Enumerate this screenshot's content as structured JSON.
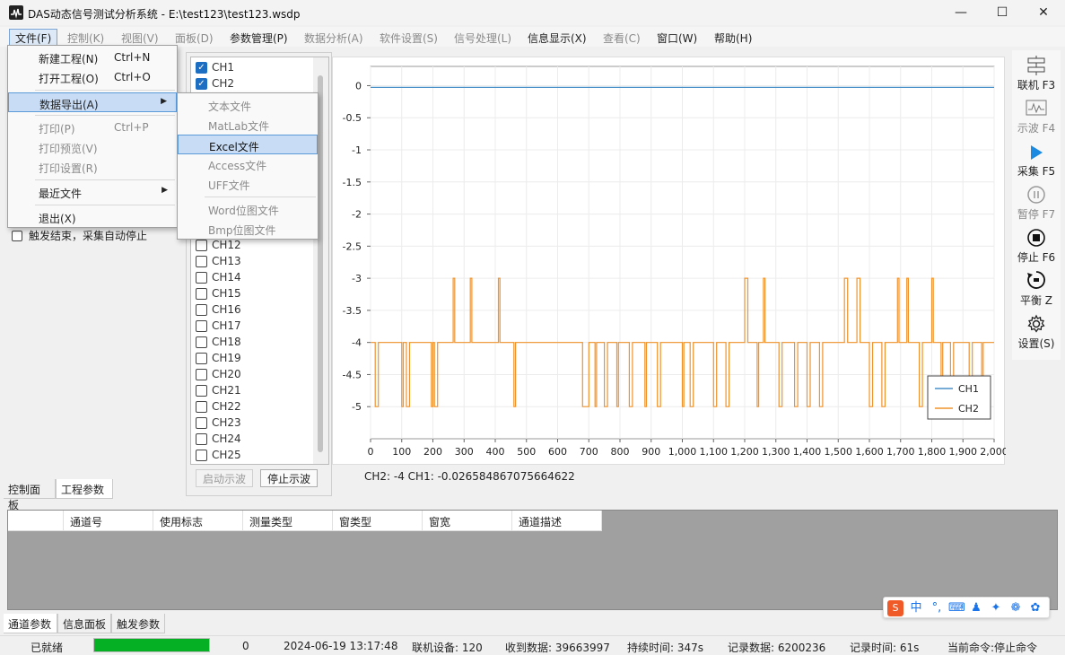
{
  "window": {
    "title": "DAS动态信号测试分析系统 - E:\\test123\\test123.wsdp",
    "minimize": "—",
    "maximize": "☐",
    "close": "✕"
  },
  "menu": [
    {
      "label": "文件(F)",
      "state": "selected"
    },
    {
      "label": "控制(K)",
      "state": "disabled"
    },
    {
      "label": "视图(V)",
      "state": "disabled"
    },
    {
      "label": "面板(D)",
      "state": "disabled"
    },
    {
      "label": "参数管理(P)",
      "state": "enabled"
    },
    {
      "label": "数据分析(A)",
      "state": "disabled"
    },
    {
      "label": "软件设置(S)",
      "state": "disabled"
    },
    {
      "label": "信号处理(L)",
      "state": "disabled"
    },
    {
      "label": "信息显示(X)",
      "state": "enabled"
    },
    {
      "label": "查看(C)",
      "state": "disabled"
    },
    {
      "label": "窗口(W)",
      "state": "enabled"
    },
    {
      "label": "帮助(H)",
      "state": "enabled"
    }
  ],
  "file_menu": {
    "new_project": "新建工程(N)",
    "new_shortcut": "Ctrl+N",
    "open_project": "打开工程(O)",
    "open_shortcut": "Ctrl+O",
    "export": "数据导出(A)",
    "print": "打印(P)",
    "print_shortcut": "Ctrl+P",
    "print_preview": "打印预览(V)",
    "print_setup": "打印设置(R)",
    "recent": "最近文件",
    "exit": "退出(X)"
  },
  "export_menu": {
    "text": "文本文件",
    "matlab": "MatLab文件",
    "excel": "Excel文件",
    "access": "Access文件",
    "uff": "UFF文件",
    "word": "Word位图文件",
    "bmp": "Bmp位图文件"
  },
  "left_panel": {
    "trigger_label": "触发结束，采集自动停止",
    "tabs": [
      "控制面板",
      "工程参数"
    ]
  },
  "channels": [
    {
      "label": "CH1",
      "checked": true
    },
    {
      "label": "CH2",
      "checked": true
    },
    {
      "label": "CH12",
      "checked": false
    },
    {
      "label": "CH13",
      "checked": false
    },
    {
      "label": "CH14",
      "checked": false
    },
    {
      "label": "CH15",
      "checked": false
    },
    {
      "label": "CH16",
      "checked": false
    },
    {
      "label": "CH17",
      "checked": false
    },
    {
      "label": "CH18",
      "checked": false
    },
    {
      "label": "CH19",
      "checked": false
    },
    {
      "label": "CH20",
      "checked": false
    },
    {
      "label": "CH21",
      "checked": false
    },
    {
      "label": "CH22",
      "checked": false
    },
    {
      "label": "CH23",
      "checked": false
    },
    {
      "label": "CH24",
      "checked": false
    },
    {
      "label": "CH25",
      "checked": false
    }
  ],
  "scope_buttons": {
    "start": "启动示波",
    "stop": "停止示波"
  },
  "readout": "CH2: -4 CH1: -0.026584867075664622",
  "right_toolbar": [
    {
      "label": "联机 F3",
      "icon": "connect-icon",
      "disabled": false
    },
    {
      "label": "示波 F4",
      "icon": "oscilloscope-icon",
      "disabled": true
    },
    {
      "label": "采集 F5",
      "icon": "play-icon",
      "disabled": false
    },
    {
      "label": "暂停 F7",
      "icon": "pause-icon",
      "disabled": true
    },
    {
      "label": "停止 F6",
      "icon": "stop-icon",
      "disabled": false
    },
    {
      "label": "平衡 Z",
      "icon": "balance-icon",
      "disabled": false
    },
    {
      "label": "设置(S)",
      "icon": "gear-icon",
      "disabled": false
    }
  ],
  "grid": {
    "headers": [
      "通道号",
      "使用标志",
      "测量类型",
      "窗类型",
      "窗宽",
      "通道描述"
    ]
  },
  "bottom_tabs": [
    "通道参数",
    "信息面板",
    "触发参数"
  ],
  "status": {
    "state": "已就绪",
    "progress": 1.0,
    "count": "0",
    "datetime": "2024-06-19 13:17:48",
    "devices": "联机设备: 120",
    "received": "收到数据: 39663997",
    "duration": "持续时间: 347s",
    "records": "记录数据: 6200236",
    "record_time": "记录时间: 61s",
    "command": "当前命令:停止命令"
  },
  "colors": {
    "ch1": "#4a90c8",
    "ch2": "#f0932b",
    "accent": "#1b6ec2",
    "progress": "#06b025"
  },
  "chart_data": {
    "type": "line",
    "xlim": [
      0,
      2000
    ],
    "ylim": [
      -5.5,
      0.3
    ],
    "xticks": [
      "0",
      "100",
      "200",
      "300",
      "400",
      "500",
      "600",
      "700",
      "800",
      "900",
      "1,000",
      "1,100",
      "1,200",
      "1,300",
      "1,400",
      "1,500",
      "1,600",
      "1,700",
      "1,800",
      "1,900",
      "2,000"
    ],
    "yticks": [
      "0",
      "-0.5",
      "-1",
      "-1.5",
      "-2",
      "-2.5",
      "-3",
      "-3.5",
      "-4",
      "-4.5",
      "-5"
    ],
    "grid": true,
    "legend_position": "bottom-right",
    "series": [
      {
        "name": "CH1",
        "color": "#4a90c8",
        "points": [
          [
            0,
            -0.027
          ],
          [
            2000,
            -0.027
          ]
        ]
      },
      {
        "name": "CH2",
        "color": "#f0932b",
        "points": [
          [
            0,
            -4
          ],
          [
            15,
            -4
          ],
          [
            15,
            -5
          ],
          [
            25,
            -5
          ],
          [
            25,
            -4
          ],
          [
            100,
            -4
          ],
          [
            100,
            -5
          ],
          [
            105,
            -5
          ],
          [
            105,
            -4
          ],
          [
            115,
            -4
          ],
          [
            115,
            -5
          ],
          [
            125,
            -5
          ],
          [
            125,
            -4
          ],
          [
            195,
            -4
          ],
          [
            195,
            -5
          ],
          [
            200,
            -5
          ],
          [
            200,
            -4
          ],
          [
            205,
            -4
          ],
          [
            205,
            -5
          ],
          [
            215,
            -5
          ],
          [
            215,
            -4
          ],
          [
            265,
            -4
          ],
          [
            265,
            -3
          ],
          [
            270,
            -3
          ],
          [
            270,
            -4
          ],
          [
            320,
            -4
          ],
          [
            320,
            -3
          ],
          [
            325,
            -3
          ],
          [
            325,
            -4
          ],
          [
            410,
            -4
          ],
          [
            410,
            -3
          ],
          [
            415,
            -3
          ],
          [
            415,
            -4
          ],
          [
            460,
            -4
          ],
          [
            460,
            -5
          ],
          [
            465,
            -5
          ],
          [
            465,
            -4
          ],
          [
            680,
            -4
          ],
          [
            680,
            -5
          ],
          [
            700,
            -5
          ],
          [
            700,
            -4
          ],
          [
            720,
            -4
          ],
          [
            720,
            -5
          ],
          [
            725,
            -5
          ],
          [
            725,
            -4
          ],
          [
            750,
            -4
          ],
          [
            750,
            -5
          ],
          [
            760,
            -5
          ],
          [
            760,
            -4
          ],
          [
            790,
            -4
          ],
          [
            790,
            -5
          ],
          [
            795,
            -5
          ],
          [
            795,
            -4
          ],
          [
            830,
            -4
          ],
          [
            830,
            -5
          ],
          [
            840,
            -5
          ],
          [
            840,
            -4
          ],
          [
            880,
            -4
          ],
          [
            880,
            -5
          ],
          [
            885,
            -5
          ],
          [
            885,
            -4
          ],
          [
            920,
            -4
          ],
          [
            920,
            -5
          ],
          [
            930,
            -5
          ],
          [
            930,
            -4
          ],
          [
            1000,
            -4
          ],
          [
            1000,
            -5
          ],
          [
            1005,
            -5
          ],
          [
            1005,
            -4
          ],
          [
            1025,
            -4
          ],
          [
            1025,
            -5
          ],
          [
            1035,
            -5
          ],
          [
            1035,
            -4
          ],
          [
            1100,
            -4
          ],
          [
            1100,
            -5
          ],
          [
            1110,
            -5
          ],
          [
            1110,
            -4
          ],
          [
            1140,
            -4
          ],
          [
            1140,
            -5
          ],
          [
            1150,
            -5
          ],
          [
            1150,
            -4
          ],
          [
            1200,
            -4
          ],
          [
            1200,
            -3
          ],
          [
            1210,
            -3
          ],
          [
            1210,
            -4
          ],
          [
            1240,
            -4
          ],
          [
            1240,
            -5
          ],
          [
            1245,
            -5
          ],
          [
            1245,
            -4
          ],
          [
            1260,
            -4
          ],
          [
            1260,
            -3
          ],
          [
            1265,
            -3
          ],
          [
            1265,
            -4
          ],
          [
            1310,
            -4
          ],
          [
            1310,
            -5
          ],
          [
            1320,
            -5
          ],
          [
            1320,
            -4
          ],
          [
            1360,
            -4
          ],
          [
            1360,
            -5
          ],
          [
            1370,
            -5
          ],
          [
            1370,
            -4
          ],
          [
            1400,
            -4
          ],
          [
            1400,
            -5
          ],
          [
            1410,
            -5
          ],
          [
            1410,
            -4
          ],
          [
            1440,
            -4
          ],
          [
            1440,
            -5
          ],
          [
            1450,
            -5
          ],
          [
            1450,
            -4
          ],
          [
            1520,
            -4
          ],
          [
            1520,
            -3
          ],
          [
            1530,
            -3
          ],
          [
            1530,
            -4
          ],
          [
            1560,
            -4
          ],
          [
            1560,
            -3
          ],
          [
            1570,
            -3
          ],
          [
            1570,
            -4
          ],
          [
            1600,
            -4
          ],
          [
            1600,
            -5
          ],
          [
            1610,
            -5
          ],
          [
            1610,
            -4
          ],
          [
            1640,
            -4
          ],
          [
            1640,
            -5
          ],
          [
            1650,
            -5
          ],
          [
            1650,
            -4
          ],
          [
            1690,
            -4
          ],
          [
            1690,
            -3
          ],
          [
            1695,
            -3
          ],
          [
            1695,
            -4
          ],
          [
            1720,
            -4
          ],
          [
            1720,
            -3
          ],
          [
            1725,
            -3
          ],
          [
            1725,
            -4
          ],
          [
            1760,
            -4
          ],
          [
            1760,
            -5
          ],
          [
            1770,
            -5
          ],
          [
            1770,
            -4
          ],
          [
            1800,
            -4
          ],
          [
            1800,
            -3
          ],
          [
            1805,
            -3
          ],
          [
            1805,
            -4
          ],
          [
            1830,
            -4
          ],
          [
            1830,
            -5
          ],
          [
            1835,
            -5
          ],
          [
            1835,
            -4
          ],
          [
            1860,
            -4
          ],
          [
            1860,
            -5
          ],
          [
            1870,
            -5
          ],
          [
            1870,
            -4
          ],
          [
            1920,
            -4
          ],
          [
            1920,
            -5
          ],
          [
            1930,
            -5
          ],
          [
            1930,
            -4
          ],
          [
            1960,
            -4
          ],
          [
            1960,
            -5
          ],
          [
            1965,
            -5
          ],
          [
            1965,
            -4
          ],
          [
            2000,
            -4
          ]
        ]
      }
    ]
  }
}
